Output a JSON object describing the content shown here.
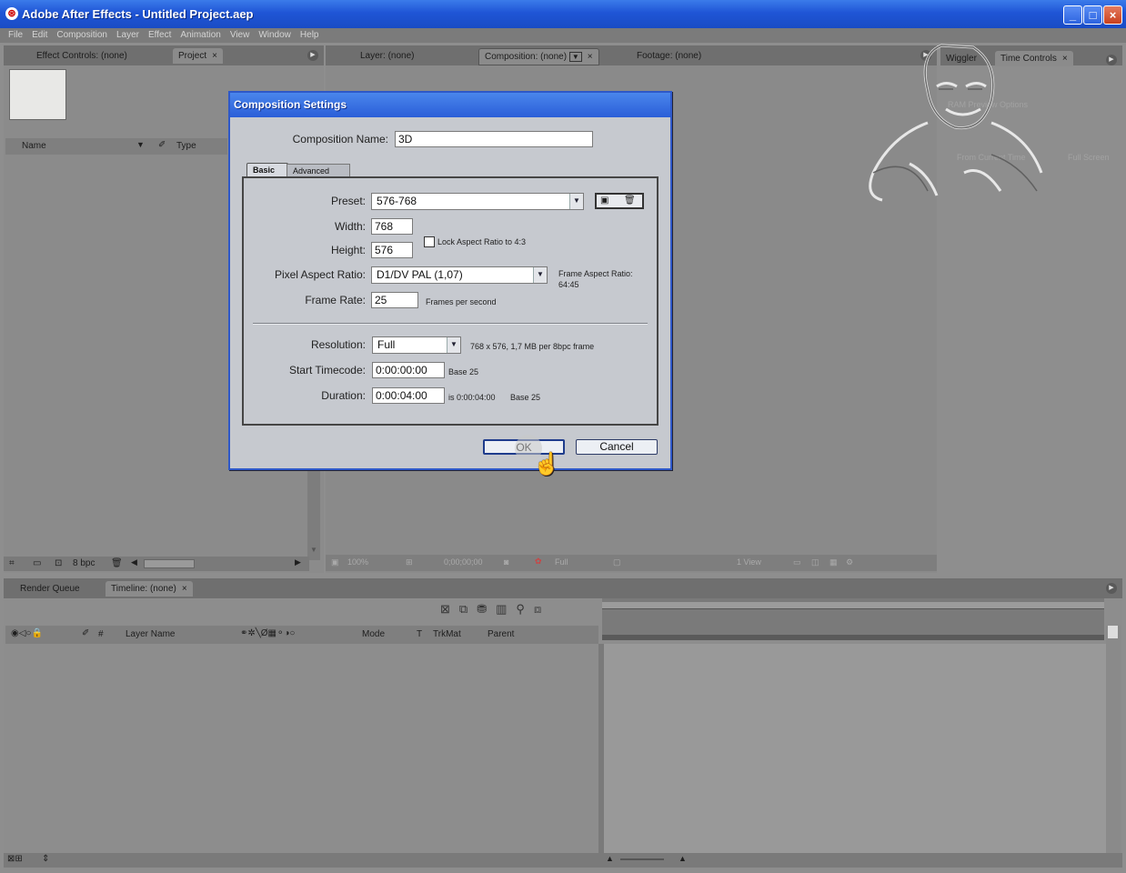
{
  "app": {
    "title": "Adobe After Effects - Untitled Project.aep",
    "icon": "after-effects-icon"
  },
  "window_controls": {
    "minimize": "_",
    "maximize": "□",
    "close": "×"
  },
  "menu": [
    "File",
    "Edit",
    "Composition",
    "Layer",
    "Effect",
    "Animation",
    "View",
    "Window",
    "Help"
  ],
  "left_panel": {
    "tabs": [
      {
        "label": "Effect Controls: (none)"
      },
      {
        "label": "Project"
      }
    ],
    "close_glyph": "×",
    "columns": {
      "name": "Name",
      "type": "Type"
    },
    "bpc": "8 bpc"
  },
  "viewer_panel": {
    "tabs": [
      {
        "label": "Layer: (none)"
      },
      {
        "label": "Composition: (none)"
      },
      {
        "label": "Footage: (none)"
      }
    ],
    "toolbar": {
      "zoom": "100%",
      "timecode": "0;00;00;00",
      "resolution": "Full",
      "views": "1 View"
    }
  },
  "right_panel": {
    "tabs": [
      {
        "label": "Wiggler"
      },
      {
        "label": "Time Controls"
      }
    ],
    "faded_labels": [
      "RAM Preview Options",
      "From Current Time",
      "Full Screen"
    ]
  },
  "timeline": {
    "tabs": [
      {
        "label": "Render Queue"
      },
      {
        "label": "Timeline: (none)"
      }
    ],
    "columns": {
      "num": "#",
      "layer_name": "Layer Name",
      "mode": "Mode",
      "t": "T",
      "trkmat": "TrkMat",
      "parent": "Parent"
    }
  },
  "dialog": {
    "title": "Composition Settings",
    "comp_name_label": "Composition Name:",
    "comp_name_value": "3D",
    "tabs": [
      {
        "label": "Basic",
        "active": true
      },
      {
        "label": "Advanced",
        "active": false
      }
    ],
    "preset_label": "Preset:",
    "preset_value": "576-768",
    "width_label": "Width:",
    "width_value": "768",
    "height_label": "Height:",
    "height_value": "576",
    "lock_label": "Lock Aspect Ratio to 4:3",
    "lock_checked": false,
    "par_label": "Pixel Aspect Ratio:",
    "par_value": "D1/DV PAL (1,07)",
    "frame_aspect_label": "Frame Aspect Ratio:",
    "frame_aspect_value": "64:45",
    "frame_rate_label": "Frame Rate:",
    "frame_rate_value": "25",
    "frame_rate_unit": "Frames per second",
    "resolution_label": "Resolution:",
    "resolution_value": "Full",
    "resolution_info": "768 x 576, 1,7 MB per 8bpc frame",
    "start_tc_label": "Start Timecode:",
    "start_tc_value": "0:00:00:00",
    "start_tc_note": "Base 25",
    "duration_label": "Duration:",
    "duration_value": "0:00:04:00",
    "duration_note_is": "is 0:00:04:00",
    "duration_note_base": "Base 25",
    "ok_label": "OK",
    "cancel_label": "Cancel"
  },
  "colors": {
    "xp_blue": "#2a5ed8",
    "panel_gray": "#8b8b8b",
    "dialog_bg": "#c6c9cf"
  }
}
